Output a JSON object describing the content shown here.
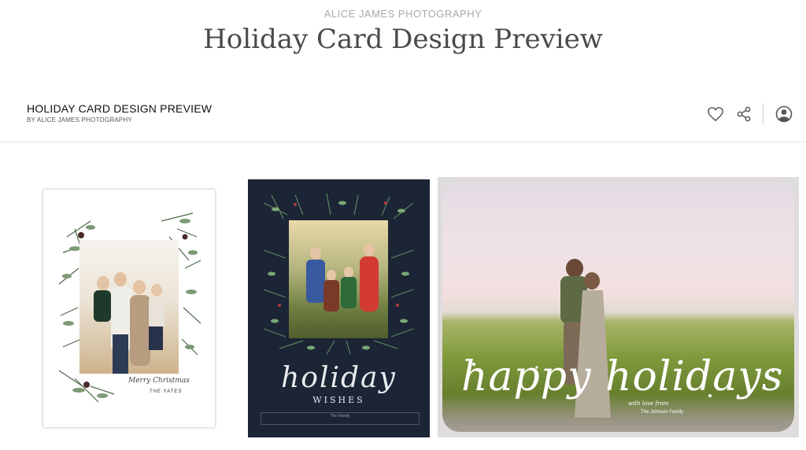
{
  "brand": "ALICE JAMES PHOTOGRAPHY",
  "page_title": "Holiday Card Design Preview",
  "gallery": {
    "title": "HOLIDAY CARD DESIGN PREVIEW",
    "subtitle": "BY ALICE JAMES PHOTOGRAPHY",
    "actions": [
      {
        "name": "heart-icon",
        "label": "Favorite"
      },
      {
        "name": "share-icon",
        "label": "Share"
      },
      {
        "name": "account-icon",
        "label": "Account"
      }
    ]
  },
  "cards": [
    {
      "script": "Merry Christmas",
      "name": "THE YATES"
    },
    {
      "title": "holiday",
      "subtitle": "WISHES",
      "box_text": "The Family"
    },
    {
      "title": "happy holidays",
      "note": "with love from",
      "name": "The Johnson Family"
    }
  ]
}
